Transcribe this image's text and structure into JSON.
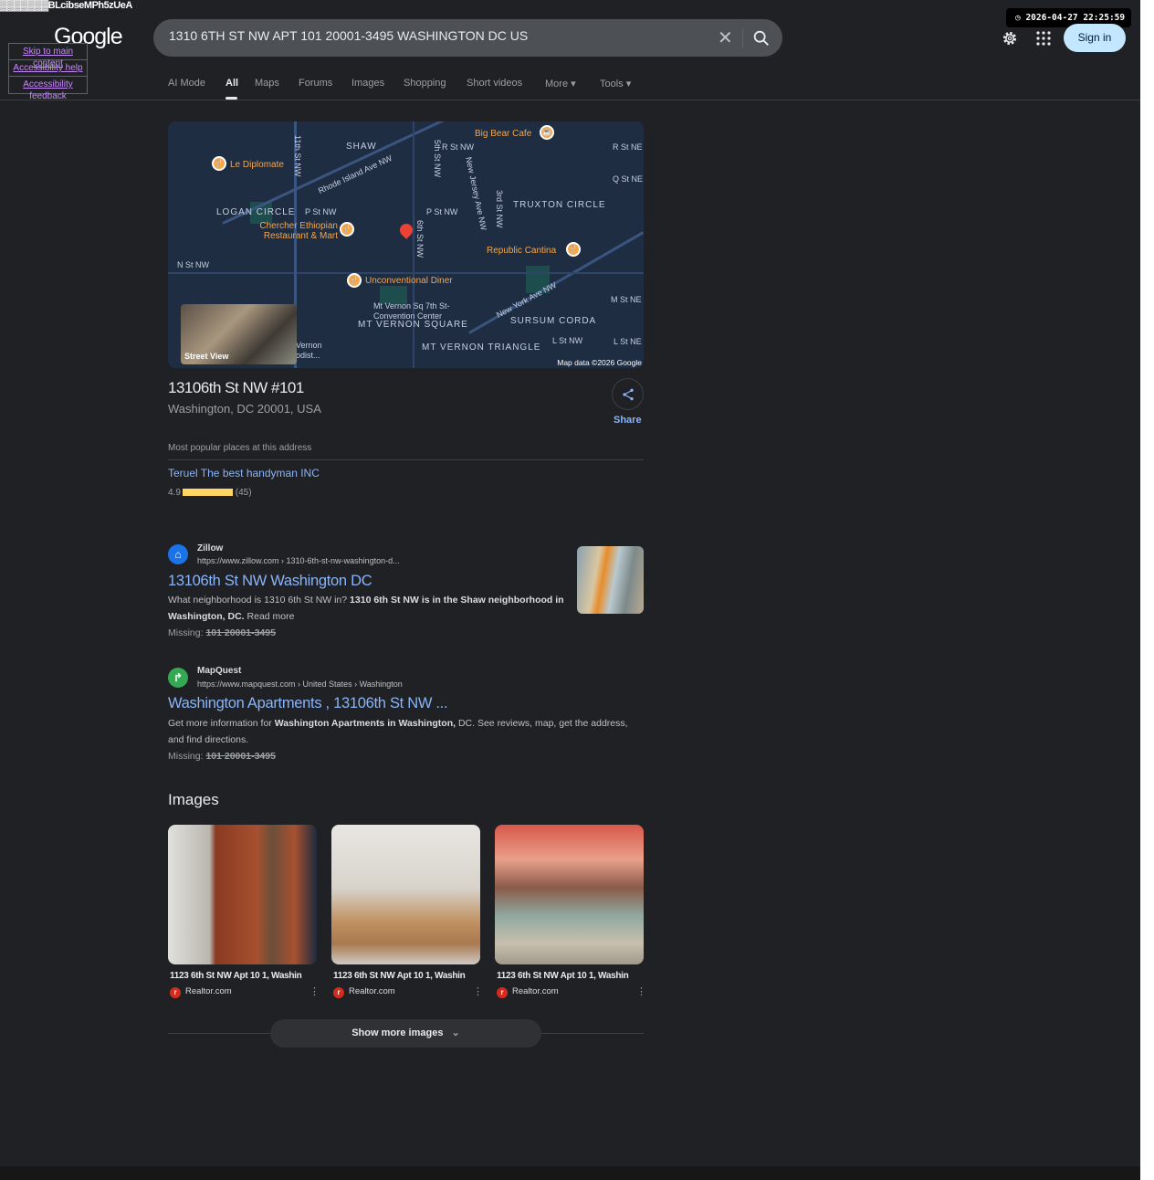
{
  "tab_id_text": "▓▓▓▓▓▓▓BLcibseMPh5zUeA",
  "logo": "Google",
  "skip_links": [
    "Skip to main content",
    "Accessibility help",
    "Accessibility feedback"
  ],
  "search": {
    "query": "1310 6TH ST NW APT 101 20001-3495 WASHINGTON DC US",
    "clear_icon": "close-icon",
    "search_icon": "magnifier-icon"
  },
  "clock": "2026-04-27 22:25:59",
  "header": {
    "sign_in": "Sign in",
    "settings_icon": "gear-icon",
    "apps_icon": "grid-icon"
  },
  "tabs": [
    {
      "label": "AI Mode"
    },
    {
      "label": "All",
      "active": true
    },
    {
      "label": "Maps"
    },
    {
      "label": "Forums"
    },
    {
      "label": "Images"
    },
    {
      "label": "Shopping"
    },
    {
      "label": "Short videos"
    },
    {
      "label": "More ▾"
    },
    {
      "label": "Tools ▾"
    }
  ],
  "map": {
    "neighborhoods": [
      "SHAW",
      "LOGAN CIRCLE",
      "TRUXTON CIRCLE",
      "SURSUM CORDA",
      "MT VERNON SQUARE",
      "MT VERNON TRIANGLE"
    ],
    "streets": [
      "Rhode Island Ave NW",
      "11th St NW",
      "5th St NW",
      "New Jersey Ave NW",
      "3rd St NW",
      "6th St NW",
      "R St NW",
      "P St NW",
      "N St NW",
      "New York Ave NW",
      "R St NE",
      "Q St NE",
      "M St NE",
      "L St NW",
      "L St NE",
      "P St NW"
    ],
    "pois": [
      "Le Diplomate",
      "Big Bear Cafe",
      "Chercher Ethiopian Restaurant & Mart",
      "Republic Cantina",
      "Unconventional Diner",
      "Mt Vernon Sq 7th St-Convention Center",
      "Vernon odist..."
    ],
    "street_view": "Street View",
    "attribution": "Map data ©2026 Google"
  },
  "place": {
    "title": "13106th St NW #101",
    "address": "Washington, DC 20001, USA",
    "share": "Share",
    "popular_heading": "Most popular places at this address",
    "business": "Teruel The best handyman INC",
    "rating": "4.9",
    "rating_fraction": 0.98,
    "reviews": "(45)"
  },
  "results": [
    {
      "site": "Zillow",
      "url": "https://www.zillow.com › 1310-6th-st-nw-washington-d...",
      "title": "13106th St NW Washington DC",
      "snippet_plain1": "What neighborhood is 1310 6th St NW in? ",
      "snippet_bold1": "1310 6th St NW is in the Shaw neighborhood in Washington, DC.",
      "snippet_plain2": "  Read more",
      "missing_label": "Missing: ",
      "missing": "101 20001-3495",
      "color": "#1a73e8"
    },
    {
      "site": "MapQuest",
      "url": "https://www.mapquest.com › United States › Washington",
      "title": "Washington Apartments , 13106th St NW ...",
      "snippet_plain1": "Get more information for ",
      "snippet_bold1": "Washington Apartments in Washington,",
      "snippet_plain2": " DC. See reviews, map, get the address, and find directions.",
      "missing_label": "Missing: ",
      "missing": "101 20001-3495",
      "color": "#34a853"
    }
  ],
  "images": {
    "heading": "Images",
    "items": [
      {
        "caption": "1123 6th St NW Apt 10 1, Washin",
        "source": "Realtor.com"
      },
      {
        "caption": "1123 6th St NW Apt 10 1, Washin",
        "source": "Realtor.com"
      },
      {
        "caption": "1123 6th St NW Apt 10 1, Washin",
        "source": "Realtor.com"
      }
    ],
    "show_more": "Show more images"
  }
}
